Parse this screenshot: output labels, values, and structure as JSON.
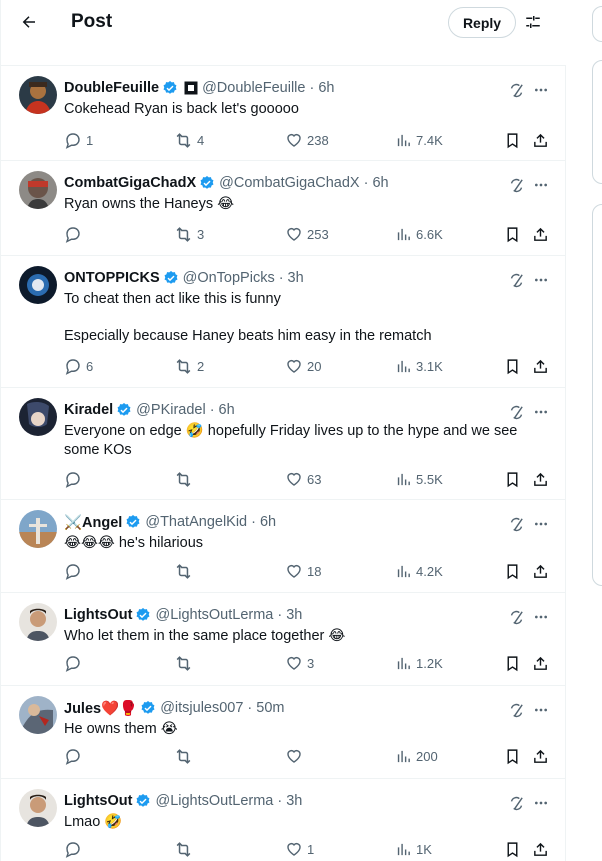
{
  "header": {
    "title": "Post",
    "reply_label": "Reply"
  },
  "tweets": [
    {
      "name": "DoubleFeuille",
      "handle": "@DoubleFeuille",
      "time": "· 6h",
      "text1": "Cokehead Ryan is back let's gooooo",
      "text2": "",
      "replies": "1",
      "retweets": "4",
      "likes": "238",
      "views": "7.4K"
    },
    {
      "name": "CombatGigaChadX",
      "handle": "@CombatGigaChadX",
      "time": "· 6h",
      "text1": "Ryan owns the Haneys 😂",
      "text2": "",
      "replies": "",
      "retweets": "3",
      "likes": "253",
      "views": "6.6K"
    },
    {
      "name": "ONTOPPICKS",
      "handle": "@OnTopPicks",
      "time": "· 3h",
      "text1": "To cheat then act like this is funny",
      "text2": "Especially because Haney beats him easy in the rematch",
      "replies": "6",
      "retweets": "2",
      "likes": "20",
      "views": "3.1K"
    },
    {
      "name": "Kiradel",
      "handle": "@PKiradel",
      "time": "· 6h",
      "text1": "Everyone on edge 🤣 hopefully Friday lives up to the hype and we see some KOs",
      "text2": "",
      "replies": "",
      "retweets": "",
      "likes": "63",
      "views": "5.5K"
    },
    {
      "name": "⚔️Angel",
      "handle": "@ThatAngelKid",
      "time": "· 6h",
      "text1": "😂😂😂 he's hilarious",
      "text2": "",
      "replies": "",
      "retweets": "",
      "likes": "18",
      "views": "4.2K"
    },
    {
      "name": "LightsOut",
      "handle": "@LightsOutLerma",
      "time": "· 3h",
      "text1": "Who let them in the same place together 😂",
      "text2": "",
      "replies": "",
      "retweets": "",
      "likes": "3",
      "views": "1.2K"
    },
    {
      "name": "Jules❤️🥊",
      "handle": "@itsjules007",
      "time": "· 50m",
      "text1": "He owns them 😭",
      "text2": "",
      "replies": "",
      "retweets": "",
      "likes": "",
      "views": "200"
    },
    {
      "name": "LightsOut",
      "handle": "@LightsOutLerma",
      "time": "· 3h",
      "text1": "Lmao 🤣",
      "text2": "",
      "replies": "",
      "retweets": "",
      "likes": "1",
      "views": "1K"
    }
  ],
  "colors": {
    "verified": "#1d9bf0",
    "muted": "#536471",
    "divider": "#eff3f4"
  }
}
